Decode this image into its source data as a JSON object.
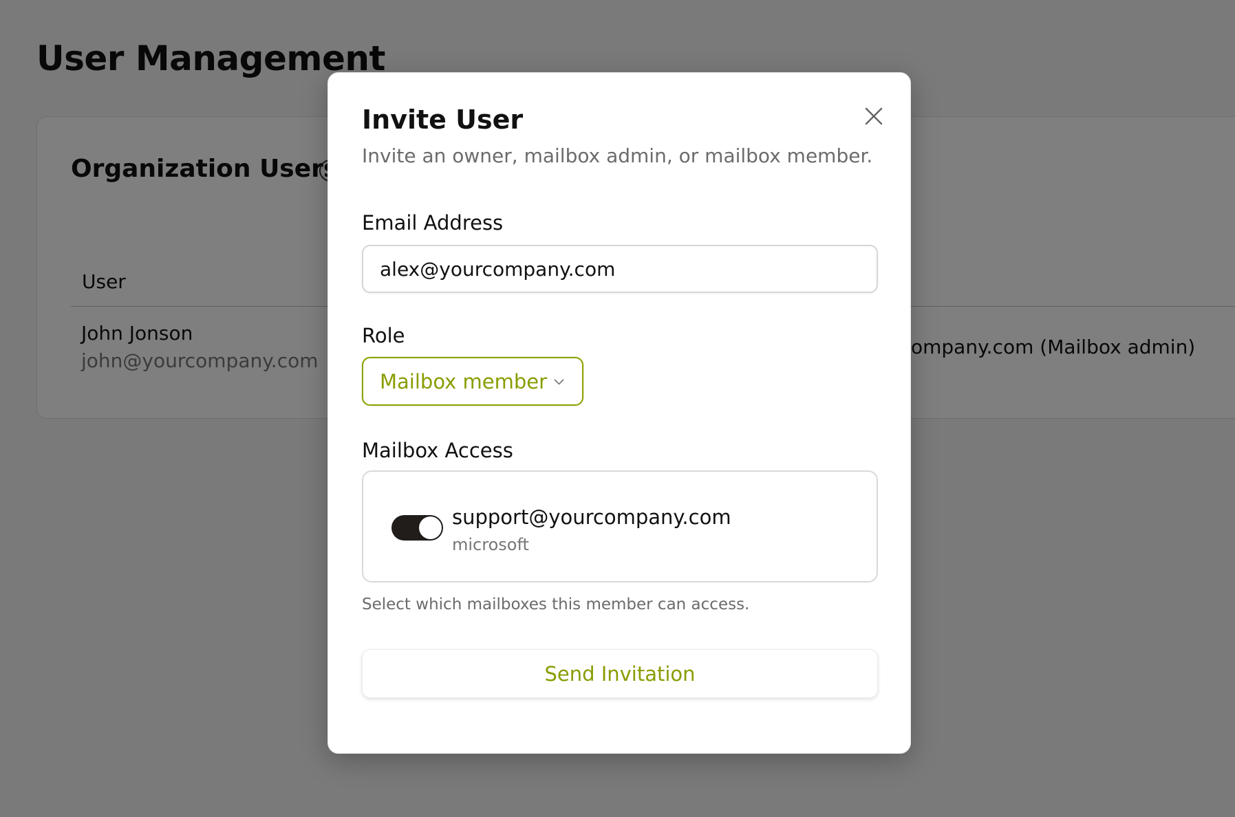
{
  "page": {
    "title": "User Management"
  },
  "card": {
    "title": "Organization Users",
    "columns": {
      "user": "User"
    },
    "rows": [
      {
        "name": "John Jonson",
        "email": "john@yourcompany.com",
        "mailbox_partial": "ompany.com (Mailbox admin)"
      }
    ]
  },
  "modal": {
    "title": "Invite User",
    "subtitle": "Invite an owner, mailbox admin, or mailbox member.",
    "email_label": "Email Address",
    "email_value": "alex@yourcompany.com",
    "role_label": "Role",
    "role_value": "Mailbox member",
    "access_label": "Mailbox Access",
    "mailboxes": [
      {
        "email": "support@yourcompany.com",
        "provider": "microsoft",
        "enabled": true
      }
    ],
    "access_helper": "Select which mailboxes this member can access.",
    "submit_label": "Send Invitation"
  },
  "colors": {
    "accent": "#8a9c00",
    "toggle_on": "#211d1b",
    "overlay": "rgba(0,0,0,0.5)"
  },
  "icons": {
    "close": "close-icon",
    "chevron": "chevron-down-icon",
    "info": "info-icon"
  }
}
